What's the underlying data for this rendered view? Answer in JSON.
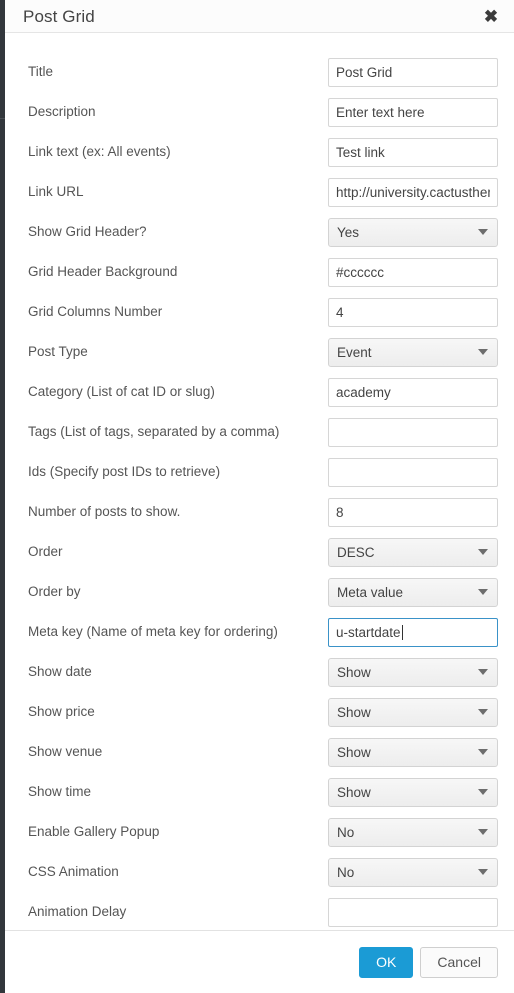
{
  "window": {
    "title": "Post Grid",
    "close_label": "✖"
  },
  "form": {
    "fields": [
      {
        "label": "Title",
        "type": "text",
        "value": "Post Grid"
      },
      {
        "label": "Description",
        "type": "text",
        "value": "Enter text here"
      },
      {
        "label": "Link text (ex: All events)",
        "type": "text",
        "value": "Test link"
      },
      {
        "label": "Link URL",
        "type": "text",
        "value": "http://university.cactusthemes.com"
      },
      {
        "label": "Show Grid Header?",
        "type": "select",
        "value": "Yes"
      },
      {
        "label": "Grid Header Background",
        "type": "text",
        "value": "#cccccc"
      },
      {
        "label": "Grid Columns Number",
        "type": "text",
        "value": "4"
      },
      {
        "label": "Post Type",
        "type": "select",
        "value": "Event"
      },
      {
        "label": "Category (List of cat ID or slug)",
        "type": "text",
        "value": "academy"
      },
      {
        "label": "Tags (List of tags, separated by a comma)",
        "type": "text",
        "value": ""
      },
      {
        "label": "Ids (Specify post IDs to retrieve)",
        "type": "text",
        "value": ""
      },
      {
        "label": "Number of posts to show.",
        "type": "text",
        "value": "8"
      },
      {
        "label": "Order",
        "type": "select",
        "value": "DESC"
      },
      {
        "label": "Order by",
        "type": "select",
        "value": "Meta value"
      },
      {
        "label": "Meta key (Name of meta key for ordering)",
        "type": "text",
        "value": "u-startdate",
        "focused": true
      },
      {
        "label": "Show date",
        "type": "select",
        "value": "Show"
      },
      {
        "label": "Show price",
        "type": "select",
        "value": "Show"
      },
      {
        "label": "Show venue",
        "type": "select",
        "value": "Show"
      },
      {
        "label": "Show time",
        "type": "select",
        "value": "Show"
      },
      {
        "label": "Enable Gallery Popup",
        "type": "select",
        "value": "No"
      },
      {
        "label": "CSS Animation",
        "type": "select",
        "value": "No"
      },
      {
        "label": "Animation Delay",
        "type": "text",
        "value": ""
      }
    ]
  },
  "footer": {
    "ok_label": "OK",
    "cancel_label": "Cancel"
  },
  "colors": {
    "accent": "#1b9bd5",
    "focus_border": "#3a92c8",
    "label_text": "#555555",
    "admin_sidebar": "#32373c"
  }
}
